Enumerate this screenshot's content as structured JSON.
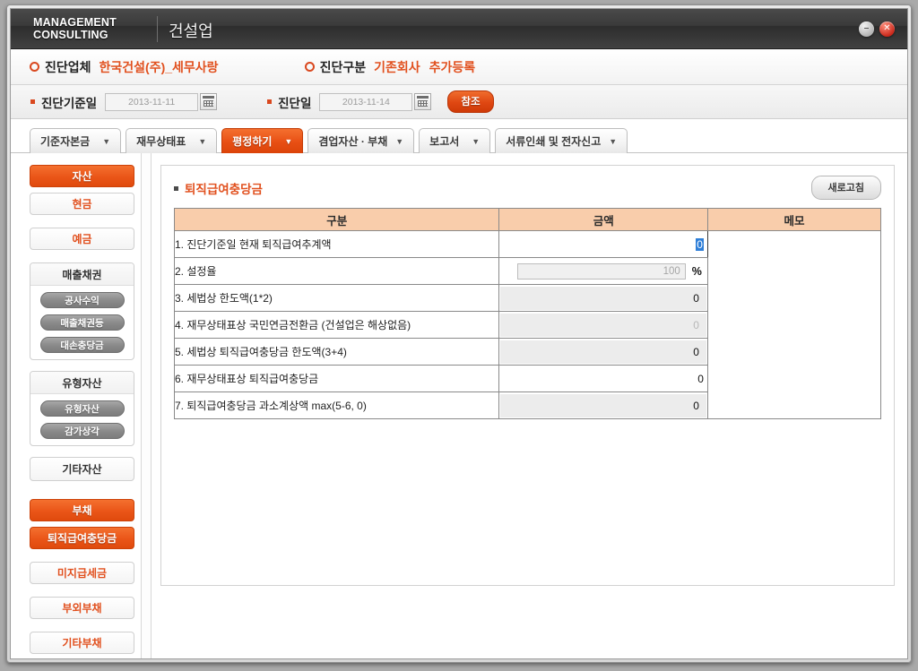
{
  "window": {
    "logo_line1": "MANAGEMENT",
    "logo_line2": "CONSULTING",
    "app_title": "건설업",
    "minimize_glyph": "–",
    "close_glyph": "✕"
  },
  "info_bar": {
    "company_label": "진단업체",
    "company_value": "한국건설(주)_세무사랑",
    "category_label": "진단구분",
    "category_value": "기존회사",
    "category_sub": "추가등록"
  },
  "date_bar": {
    "base_date_label": "진단기준일",
    "base_date_value": "2013-11-11",
    "diag_date_label": "진단일",
    "diag_date_value": "2013-11-14",
    "reference_button": "참조"
  },
  "tabs": [
    {
      "label": "기준자본금",
      "caret": "▼",
      "active": false
    },
    {
      "label": "재무상태표",
      "caret": "▼",
      "active": false
    },
    {
      "label": "평정하기",
      "caret": "▼",
      "active": true
    },
    {
      "label": "겸업자산 · 부채",
      "caret": "▼",
      "active": false
    },
    {
      "label": "보고서",
      "caret": "▼",
      "active": false
    },
    {
      "label": "서류인쇄 및 전자신고",
      "caret": "▼",
      "active": false
    }
  ],
  "sidebar": {
    "asset_header": "자산",
    "cash": "현금",
    "deposit": "예금",
    "receivable_group": {
      "header": "매출채권",
      "items": [
        "공사수익",
        "매출채권등",
        "대손충당금"
      ]
    },
    "tangible_group": {
      "header": "유형자산",
      "items": [
        "유형자산",
        "감가상각"
      ]
    },
    "other_assets": "기타자산",
    "liability_header": "부채",
    "severance": "퇴직급여충당금",
    "unpaid_tax": "미지급세금",
    "offbalance": "부외부채",
    "other_liability": "기타부채"
  },
  "panel": {
    "title": "퇴직급여충당금",
    "refresh_button": "새로고침",
    "columns": [
      "구분",
      "금액",
      "메모"
    ],
    "rows": [
      {
        "label": "1. 진단기준일 현재 퇴직급여추계액",
        "value": "0",
        "style": "white-selected"
      },
      {
        "label": "2. 설정율",
        "value": "100",
        "suffix": "%",
        "style": "input-percent"
      },
      {
        "label": "3. 세법상 한도액(1*2)",
        "value": "0",
        "style": "gray"
      },
      {
        "label": "4. 재무상태표상 국민연금전환금 (건설업은 해상없음)",
        "value": "0",
        "style": "gray-dim"
      },
      {
        "label": "5. 세법상 퇴직급여충당금 한도액(3+4)",
        "value": "0",
        "style": "gray"
      },
      {
        "label": "6. 재무상태표상 퇴직급여충당금",
        "value": "0",
        "style": "white"
      },
      {
        "label": "7. 퇴직급여충당금 과소계상액 max(5-6, 0)",
        "value": "0",
        "style": "gray"
      }
    ],
    "memo_value": ""
  },
  "colors": {
    "accent_orange": "#e1501e",
    "tab_active": "#e84f14",
    "table_header": "#f9cdab",
    "titlebar": "#3a3a3a",
    "selection_blue": "#2f7fd8"
  }
}
